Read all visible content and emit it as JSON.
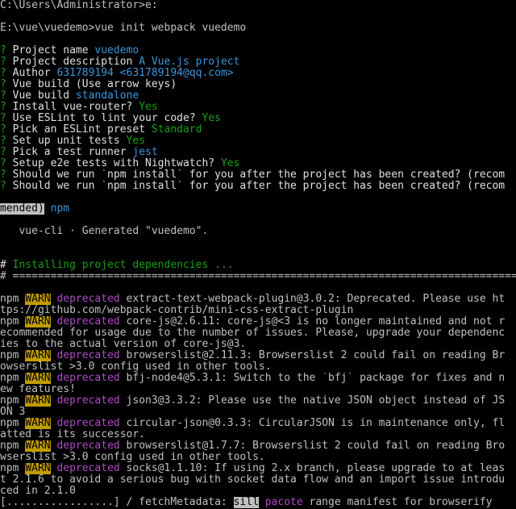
{
  "colors": {
    "background": "#000000",
    "text": "#c0c0c0",
    "prompt_mark": "#13a10e",
    "answer": "#3a96dd",
    "deprecated": "#b148c6",
    "warn_bg": "#c19c00"
  },
  "lines": {
    "l01": "C:\\Users\\Administrator>e:",
    "l03": "E:\\vue\\vuedemo>vue init webpack vuedemo",
    "q_mark": "?",
    "q01_label": " Project name ",
    "q01_value": "vuedemo",
    "q02_label": " Project description ",
    "q02_value": "A Vue.js project",
    "q03_label": " Author ",
    "q03_value": "631789194 <631789194@qq.com>",
    "q04_label": " Vue build (Use arrow keys)",
    "q05_label": " Vue build ",
    "q05_value": "standalone",
    "q06_label": " Install vue-router? ",
    "q06_value": "Yes",
    "q07_label": " Use ESLint to lint your code? ",
    "q07_value": "Yes",
    "q08_label": " Pick an ESLint preset ",
    "q08_value": "Standard",
    "q09_label": " Set up unit tests ",
    "q09_value": "Yes",
    "q10_label": " Pick a test runner ",
    "q10_value": "jest",
    "q11_label": " Setup e2e tests with Nightwatch? ",
    "q11_value": "Yes",
    "q12_label": " Should we run `npm install` for you after the project has been created? (recom",
    "q13_label": " Should we run `npm install` for you after the project has been created? (recom",
    "mended_sel": "mended)",
    "mended_value": " npm",
    "generated": "   vue-cli · Generated \"vuedemo\".",
    "hash": "#",
    "installing": " Installing project dependencies ...",
    "separator": "# ===================================================================================",
    "npm": "npm",
    "warn": "WARN",
    "deprecated": "deprecated",
    "w1a": " extract-text-webpack-plugin@3.0.2: Deprecated. Please use ht",
    "w1b": "tps://github.com/webpack-contrib/mini-css-extract-plugin",
    "w2a": " core-js@2.6.11: core-js@<3 is no longer maintained and not r",
    "w2b": "ecommended for usage due to the number of issues. Please, upgrade your dependenc",
    "w2c": "ies to the actual version of core-js@3.",
    "w3a": " browserslist@2.11.3: Browserslist 2 could fail on reading Br",
    "w3b": "owserslist >3.0 config used in other tools.",
    "w4a": " bfj-node4@5.3.1: Switch to the `bfj` package for fixes and n",
    "w4b": "ew features!",
    "w5a": " json3@3.3.2: Please use the native JSON object instead of JS",
    "w5b": "ON 3",
    "w6a": " circular-json@0.3.3: CircularJSON is in maintenance only, fl",
    "w6b": "atted is its successor.",
    "w7a": " browserslist@1.7.7: Browserslist 2 could fail on reading Bro",
    "w7b": "wserslist >3.0 config used in other tools.",
    "w8a": " socks@1.1.10: If using 2.x branch, please upgrade to at leas",
    "w8b": "t 2.1.6 to avoid a serious bug with socket data flow and an import issue introdu",
    "w8c": "ced in 2.1.0",
    "progress_bar": "[.................] / fetchMetadata: ",
    "sill": "sill",
    "pacote": " pacote",
    "progress_tail": " range manifest for browserify"
  }
}
